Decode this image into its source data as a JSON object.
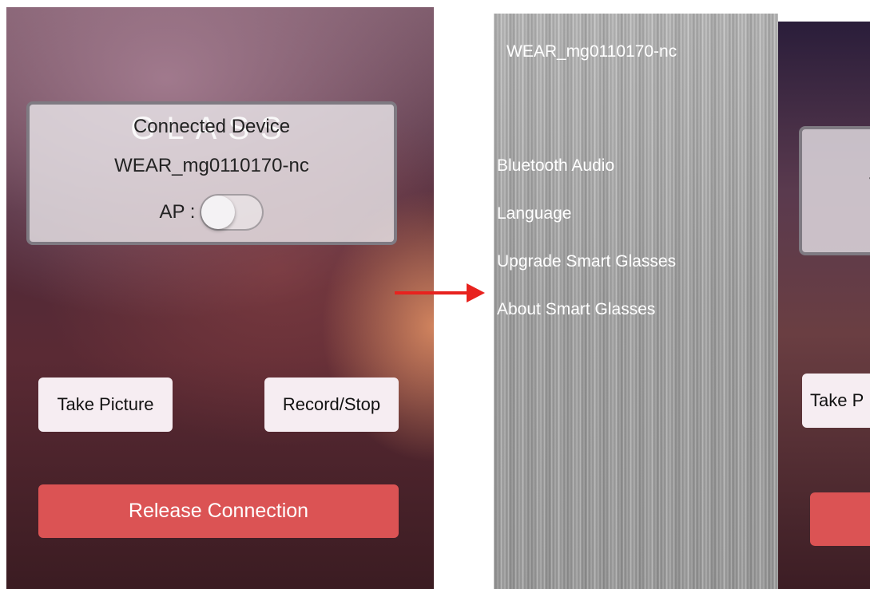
{
  "left_screen": {
    "logo_text": "GLASS",
    "card_title": "Connected Device",
    "device_name": "WEAR_mg0110170-nc",
    "ap_label": "AP :",
    "ap_toggle_on": false,
    "take_picture_label": "Take Picture",
    "record_stop_label": "Record/Stop",
    "release_connection_label": "Release Connection"
  },
  "menu": {
    "device_name": "WEAR_mg0110170-nc",
    "items": [
      {
        "label": "Bluetooth Audio"
      },
      {
        "label": "Language"
      },
      {
        "label": "Upgrade Smart Glasses"
      },
      {
        "label": "About Smart Glasses"
      }
    ]
  },
  "right_screen_partial": {
    "card_letter": "V",
    "take_picture_label": "Take P"
  },
  "colors": {
    "accent_red": "#db5354",
    "arrow_red": "#e8221e",
    "button_bg": "#f6edf2"
  }
}
